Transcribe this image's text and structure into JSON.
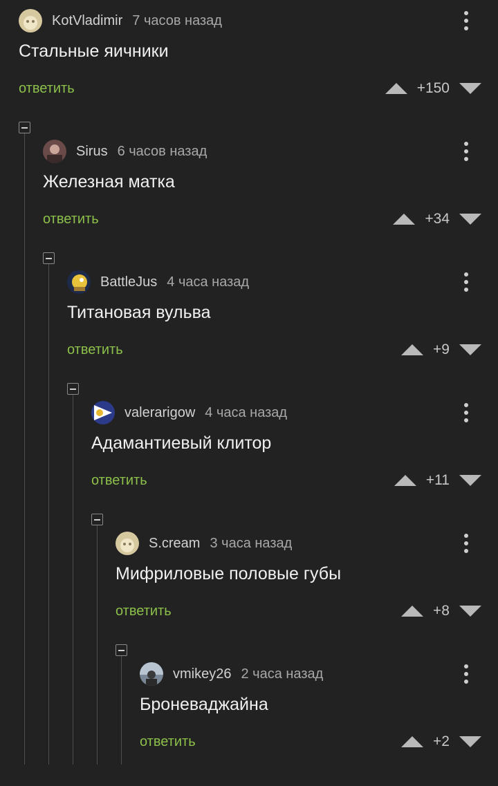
{
  "comments": [
    {
      "author": "KotVladimir",
      "time": "7 часов назад",
      "text": "Стальные яичники",
      "reply": "ответить",
      "score": "+150",
      "avatar_color": "#d6c9a0"
    },
    {
      "author": "Sirus",
      "time": "6 часов назад",
      "text": "Железная матка",
      "reply": "ответить",
      "score": "+34",
      "avatar_color": "#6b4a4a"
    },
    {
      "author": "BattleJus",
      "time": "4 часа назад",
      "text": "Титановая вульва",
      "reply": "ответить",
      "score": "+9",
      "avatar_color": "#e8c23a"
    },
    {
      "author": "valerarigow",
      "time": "4 часа назад",
      "text": "Адамантиевый клитор",
      "reply": "ответить",
      "score": "+11",
      "avatar_color": "#2c3a8a"
    },
    {
      "author": "S.cream",
      "time": "3 часа назад",
      "text": "Мифриловые половые губы",
      "reply": "ответить",
      "score": "+8",
      "avatar_color": "#d6c9a0"
    },
    {
      "author": "vmikey26",
      "time": "2 часа назад",
      "text": "Броневаджайна",
      "reply": "ответить",
      "score": "+2",
      "avatar_color": "#7a8796"
    }
  ],
  "icons": {
    "collapse": "minus-square-icon",
    "menu": "kebab-menu-icon",
    "upvote": "upvote-arrow-icon",
    "downvote": "downvote-arrow-icon"
  }
}
